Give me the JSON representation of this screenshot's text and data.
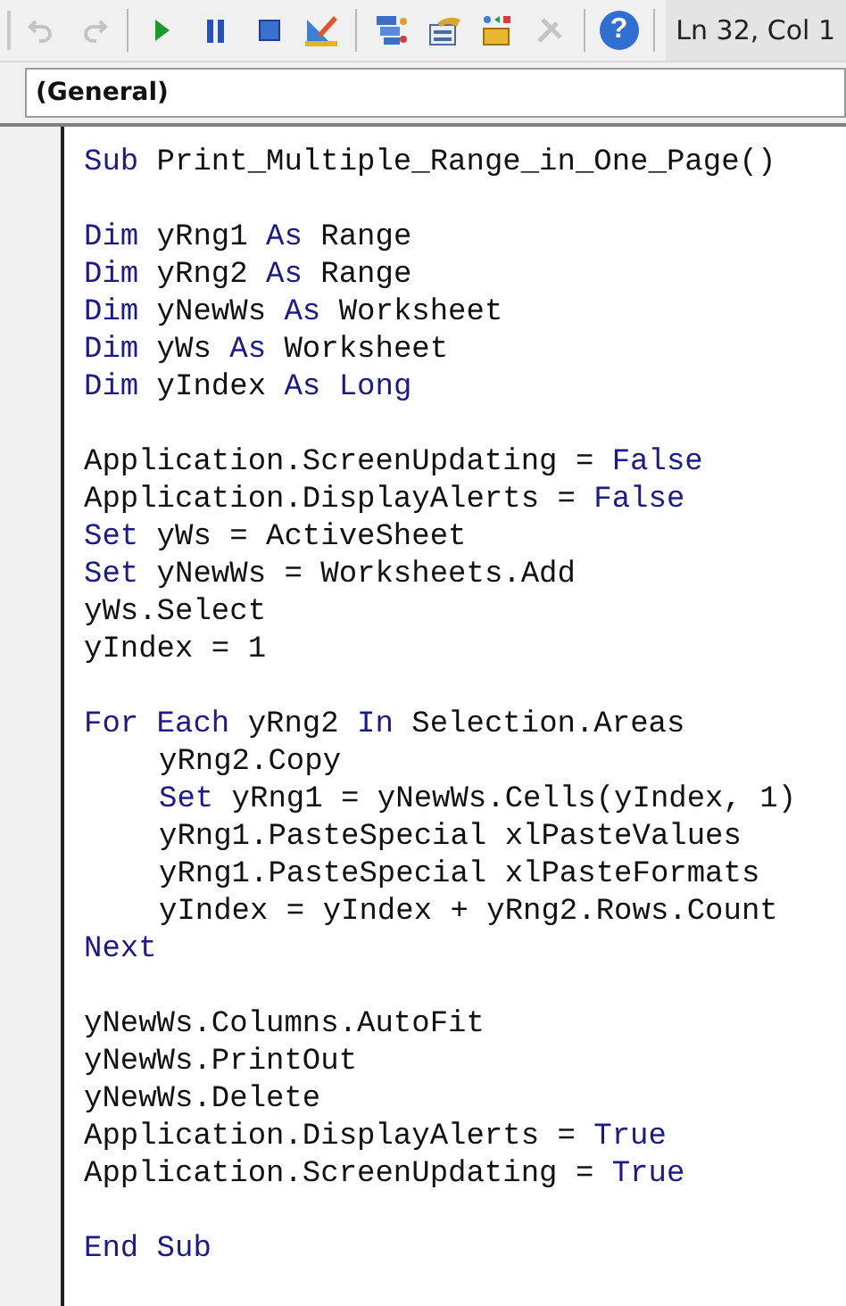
{
  "toolbar": {
    "buttons": [
      {
        "kind": "undo",
        "disabled": true
      },
      {
        "kind": "redo",
        "disabled": true
      },
      {
        "kind": "run",
        "disabled": false
      },
      {
        "kind": "pause",
        "disabled": false
      },
      {
        "kind": "stop",
        "disabled": false
      },
      {
        "kind": "design",
        "disabled": false
      },
      {
        "kind": "explorer",
        "disabled": false
      },
      {
        "kind": "properties",
        "disabled": false
      },
      {
        "kind": "browser",
        "disabled": false
      },
      {
        "kind": "toolbox",
        "disabled": true
      },
      {
        "kind": "help",
        "disabled": false,
        "glyph": "?"
      }
    ],
    "position": "Ln 32, Col 1"
  },
  "object_box": {
    "value": "(General)"
  },
  "code": {
    "blocks": [
      [
        {
          "indented": false,
          "segments": [
            {
              "kind": "keyword",
              "text": "Sub"
            },
            {
              "kind": "plain",
              "text": " Print_Multiple_Range_in_One_Page()"
            }
          ]
        }
      ],
      [
        {
          "indented": false,
          "segments": [
            {
              "kind": "keyword",
              "text": "Dim"
            },
            {
              "kind": "plain",
              "text": " yRng1 "
            },
            {
              "kind": "keyword",
              "text": "As"
            },
            {
              "kind": "plain",
              "text": " Range"
            }
          ]
        },
        {
          "indented": false,
          "segments": [
            {
              "kind": "keyword",
              "text": "Dim"
            },
            {
              "kind": "plain",
              "text": " yRng2 "
            },
            {
              "kind": "keyword",
              "text": "As"
            },
            {
              "kind": "plain",
              "text": " Range"
            }
          ]
        },
        {
          "indented": false,
          "segments": [
            {
              "kind": "keyword",
              "text": "Dim"
            },
            {
              "kind": "plain",
              "text": " yNewWs "
            },
            {
              "kind": "keyword",
              "text": "As"
            },
            {
              "kind": "plain",
              "text": " Worksheet"
            }
          ]
        },
        {
          "indented": false,
          "segments": [
            {
              "kind": "keyword",
              "text": "Dim"
            },
            {
              "kind": "plain",
              "text": " yWs "
            },
            {
              "kind": "keyword",
              "text": "As"
            },
            {
              "kind": "plain",
              "text": " Worksheet"
            }
          ]
        },
        {
          "indented": false,
          "segments": [
            {
              "kind": "keyword",
              "text": "Dim"
            },
            {
              "kind": "plain",
              "text": " yIndex "
            },
            {
              "kind": "keyword",
              "text": "As Long"
            }
          ]
        }
      ],
      [
        {
          "indented": false,
          "segments": [
            {
              "kind": "plain",
              "text": "Application.ScreenUpdating = "
            },
            {
              "kind": "keyword",
              "text": "False"
            }
          ]
        },
        {
          "indented": false,
          "segments": [
            {
              "kind": "plain",
              "text": "Application.DisplayAlerts = "
            },
            {
              "kind": "keyword",
              "text": "False"
            }
          ]
        },
        {
          "indented": false,
          "segments": [
            {
              "kind": "keyword",
              "text": "Set"
            },
            {
              "kind": "plain",
              "text": " yWs = ActiveSheet"
            }
          ]
        },
        {
          "indented": false,
          "segments": [
            {
              "kind": "keyword",
              "text": "Set"
            },
            {
              "kind": "plain",
              "text": " yNewWs = Worksheets.Add"
            }
          ]
        },
        {
          "indented": false,
          "segments": [
            {
              "kind": "plain",
              "text": "yWs.Select"
            }
          ]
        },
        {
          "indented": false,
          "segments": [
            {
              "kind": "plain",
              "text": "yIndex = 1"
            }
          ]
        }
      ],
      [
        {
          "indented": false,
          "segments": [
            {
              "kind": "keyword",
              "text": "For Each"
            },
            {
              "kind": "plain",
              "text": " yRng2 "
            },
            {
              "kind": "keyword",
              "text": "In"
            },
            {
              "kind": "plain",
              "text": " Selection.Areas"
            }
          ]
        },
        {
          "indented": true,
          "segments": [
            {
              "kind": "plain",
              "text": "yRng2.Copy"
            }
          ]
        },
        {
          "indented": true,
          "segments": [
            {
              "kind": "keyword",
              "text": "Set"
            },
            {
              "kind": "plain",
              "text": " yRng1 = yNewWs.Cells(yIndex, 1)"
            }
          ]
        },
        {
          "indented": true,
          "segments": [
            {
              "kind": "plain",
              "text": "yRng1.PasteSpecial xlPasteValues"
            }
          ]
        },
        {
          "indented": true,
          "segments": [
            {
              "kind": "plain",
              "text": "yRng1.PasteSpecial xlPasteFormats"
            }
          ]
        },
        {
          "indented": true,
          "segments": [
            {
              "kind": "plain",
              "text": "yIndex = yIndex + yRng2.Rows.Count"
            }
          ]
        },
        {
          "indented": false,
          "segments": [
            {
              "kind": "keyword",
              "text": "Next"
            }
          ]
        }
      ],
      [
        {
          "indented": false,
          "segments": [
            {
              "kind": "plain",
              "text": "yNewWs.Columns.AutoFit"
            }
          ]
        },
        {
          "indented": false,
          "segments": [
            {
              "kind": "plain",
              "text": "yNewWs.PrintOut"
            }
          ]
        },
        {
          "indented": false,
          "segments": [
            {
              "kind": "plain",
              "text": "yNewWs.Delete"
            }
          ]
        },
        {
          "indented": false,
          "segments": [
            {
              "kind": "plain",
              "text": "Application.DisplayAlerts = "
            },
            {
              "kind": "keyword",
              "text": "True"
            }
          ]
        },
        {
          "indented": false,
          "segments": [
            {
              "kind": "plain",
              "text": "Application.ScreenUpdating = "
            },
            {
              "kind": "keyword",
              "text": "True"
            }
          ]
        }
      ],
      [
        {
          "indented": false,
          "segments": [
            {
              "kind": "keyword",
              "text": "End Sub"
            }
          ]
        }
      ]
    ]
  }
}
